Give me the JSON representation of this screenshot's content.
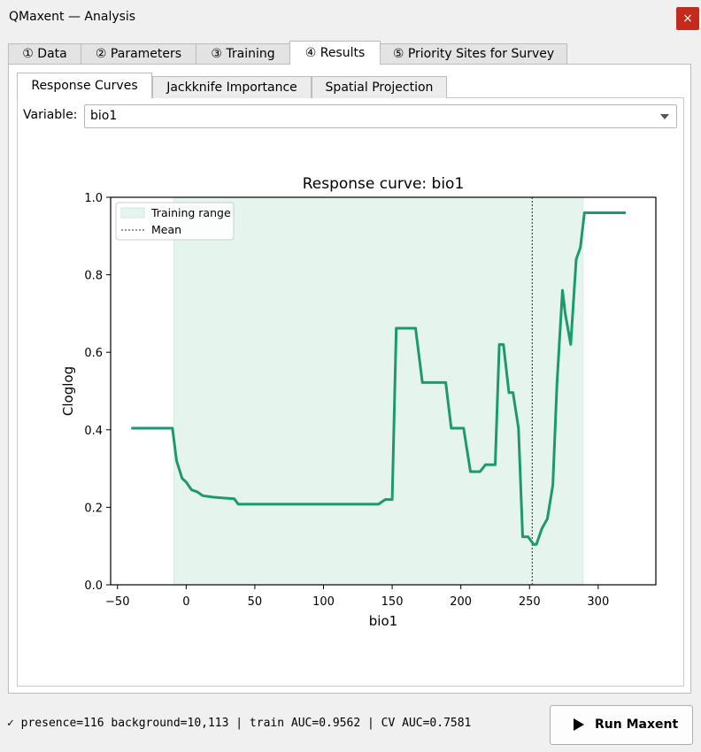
{
  "window": {
    "title": "QMaxent — Analysis",
    "close_label": "×"
  },
  "main_tabs": [
    "① Data",
    "② Parameters",
    "③ Training",
    "④ Results",
    "⑤ Priority Sites for Survey"
  ],
  "sub_tabs": [
    "Response Curves",
    "Jackknife Importance",
    "Spatial Projection"
  ],
  "variable": {
    "label": "Variable:",
    "value": "bio1"
  },
  "status_text": "✓ presence=116  background=10,113  |  train AUC=0.9562  |  CV AUC=0.7581",
  "run_button": {
    "label": "Run Maxent"
  },
  "colors": {
    "curve": "#1d9a6c",
    "range_fill": "#e6f4ee",
    "close_button": "#c42b1c"
  },
  "chart_data": {
    "type": "line",
    "title": "Response curve: bio1",
    "xlabel": "bio1",
    "ylabel": "Cloglog",
    "xlim": [
      -55,
      342
    ],
    "ylim": [
      0,
      1
    ],
    "xticks": [
      -50,
      0,
      50,
      100,
      150,
      200,
      250,
      300
    ],
    "yticks": [
      0.0,
      0.2,
      0.4,
      0.6,
      0.8,
      1.0
    ],
    "xtick_labels": [
      "−50",
      "0",
      "50",
      "100",
      "150",
      "200",
      "250",
      "300"
    ],
    "ytick_labels": [
      "0.0",
      "0.2",
      "0.4",
      "0.6",
      "0.8",
      "1.0"
    ],
    "training_range": [
      -9,
      289
    ],
    "mean": 252,
    "legend": [
      "Training range",
      "Mean"
    ],
    "legend_position": "top-left",
    "grid": false,
    "series": [
      {
        "x": [
          -40,
          -10,
          -7,
          -3,
          0,
          4,
          8,
          12,
          20,
          30,
          35,
          38,
          140,
          145,
          150,
          153,
          167,
          172,
          189,
          193,
          202,
          207,
          214,
          218,
          225,
          228,
          231,
          235,
          238,
          242,
          245,
          249,
          253,
          255,
          259,
          263,
          267,
          270,
          274,
          276,
          280,
          284,
          287,
          290,
          320
        ],
        "y": [
          0.404,
          0.404,
          0.32,
          0.275,
          0.265,
          0.245,
          0.24,
          0.23,
          0.226,
          0.223,
          0.222,
          0.208,
          0.208,
          0.22,
          0.22,
          0.662,
          0.662,
          0.522,
          0.522,
          0.404,
          0.404,
          0.292,
          0.292,
          0.31,
          0.31,
          0.62,
          0.62,
          0.496,
          0.496,
          0.404,
          0.124,
          0.124,
          0.104,
          0.104,
          0.145,
          0.17,
          0.257,
          0.52,
          0.76,
          0.7,
          0.62,
          0.84,
          0.87,
          0.96,
          0.96
        ]
      }
    ]
  }
}
